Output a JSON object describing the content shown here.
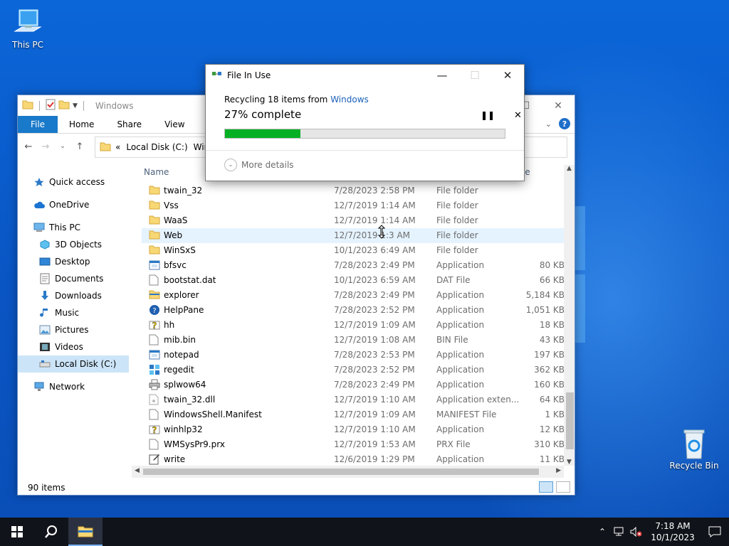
{
  "desktop": {
    "this_pc_label": "This PC",
    "recycle_bin_label": "Recycle Bin"
  },
  "explorer": {
    "title": "Windows",
    "tabs": [
      {
        "label": "File"
      },
      {
        "label": "Home"
      },
      {
        "label": "Share"
      },
      {
        "label": "View"
      }
    ],
    "address": {
      "chevrons": "«",
      "crumb1": "Local Disk (C:)",
      "crumb2": "Win"
    },
    "nav": [
      {
        "label": "Quick access",
        "icon": "star-icon"
      },
      {
        "label": "OneDrive",
        "icon": "cloud-icon"
      },
      {
        "label": "This PC",
        "icon": "computer-icon"
      },
      {
        "label": "3D Objects",
        "icon": "cube-icon"
      },
      {
        "label": "Desktop",
        "icon": "desktop-icon"
      },
      {
        "label": "Documents",
        "icon": "document-icon"
      },
      {
        "label": "Downloads",
        "icon": "download-icon"
      },
      {
        "label": "Music",
        "icon": "music-icon"
      },
      {
        "label": "Pictures",
        "icon": "picture-icon"
      },
      {
        "label": "Videos",
        "icon": "video-icon"
      },
      {
        "label": "Local Disk (C:)",
        "icon": "drive-icon"
      },
      {
        "label": "Network",
        "icon": "network-icon"
      }
    ],
    "columns": {
      "name": "Name",
      "size": "ze"
    },
    "files": [
      {
        "name": "twain_32",
        "date": "7/28/2023 2:58 PM",
        "type": "File folder",
        "size": "",
        "icon": "folder"
      },
      {
        "name": "Vss",
        "date": "12/7/2019 1:14 AM",
        "type": "File folder",
        "size": "",
        "icon": "folder"
      },
      {
        "name": "WaaS",
        "date": "12/7/2019 1:14 AM",
        "type": "File folder",
        "size": "",
        "icon": "folder"
      },
      {
        "name": "Web",
        "date": "12/7/2019 1:3  AM",
        "type": "File folder",
        "size": "",
        "icon": "folder"
      },
      {
        "name": "WinSxS",
        "date": "10/1/2023 6:49 AM",
        "type": "File folder",
        "size": "",
        "icon": "folder"
      },
      {
        "name": "bfsvc",
        "date": "7/28/2023 2:49 PM",
        "type": "Application",
        "size": "80 KB",
        "icon": "app"
      },
      {
        "name": "bootstat.dat",
        "date": "10/1/2023 6:59 AM",
        "type": "DAT File",
        "size": "66 KB",
        "icon": "file"
      },
      {
        "name": "explorer",
        "date": "7/28/2023 2:49 PM",
        "type": "Application",
        "size": "5,184 KB",
        "icon": "explorer"
      },
      {
        "name": "HelpPane",
        "date": "7/28/2023 2:52 PM",
        "type": "Application",
        "size": "1,051 KB",
        "icon": "help"
      },
      {
        "name": "hh",
        "date": "12/7/2019 1:09 AM",
        "type": "Application",
        "size": "18 KB",
        "icon": "hh"
      },
      {
        "name": "mib.bin",
        "date": "12/7/2019 1:08 AM",
        "type": "BIN File",
        "size": "43 KB",
        "icon": "file"
      },
      {
        "name": "notepad",
        "date": "7/28/2023 2:53 PM",
        "type": "Application",
        "size": "197 KB",
        "icon": "app"
      },
      {
        "name": "regedit",
        "date": "7/28/2023 2:52 PM",
        "type": "Application",
        "size": "362 KB",
        "icon": "regedit"
      },
      {
        "name": "splwow64",
        "date": "7/28/2023 2:49 PM",
        "type": "Application",
        "size": "160 KB",
        "icon": "printer"
      },
      {
        "name": "twain_32.dll",
        "date": "12/7/2019 1:10 AM",
        "type": "Application exten...",
        "size": "64 KB",
        "icon": "dll"
      },
      {
        "name": "WindowsShell.Manifest",
        "date": "12/7/2019 1:09 AM",
        "type": "MANIFEST File",
        "size": "1 KB",
        "icon": "file"
      },
      {
        "name": "winhlp32",
        "date": "12/7/2019 1:10 AM",
        "type": "Application",
        "size": "12 KB",
        "icon": "hh"
      },
      {
        "name": "WMSysPr9.prx",
        "date": "12/7/2019 1:53 AM",
        "type": "PRX File",
        "size": "310 KB",
        "icon": "file"
      },
      {
        "name": "write",
        "date": "12/6/2019 1:29 PM",
        "type": "Application",
        "size": "11 KB",
        "icon": "write"
      }
    ],
    "status": "90 items"
  },
  "dialog": {
    "title": "File In Use",
    "recycling_prefix": "Recycling 18 items from ",
    "recycling_link": "Windows",
    "percent_text": "27% complete",
    "progress_fraction": 0.27,
    "more_details": "More details"
  },
  "taskbar": {
    "time": "7:18 AM",
    "date": "10/1/2023"
  },
  "colors": {
    "accent": "#1979ca",
    "progress": "#06b025",
    "link": "#1a60b8",
    "taskbar": "#101319"
  }
}
